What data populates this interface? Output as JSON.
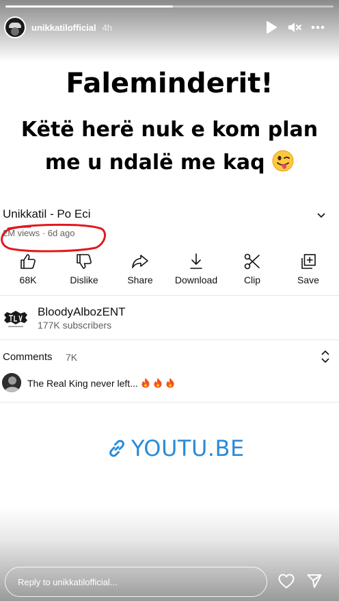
{
  "story": {
    "username": "unikkatilofficial",
    "time_ago": "4h",
    "progress_fraction": 0.51,
    "headline_1": "Faleminderit!",
    "headline_2": "Këtë herë nuk e kom plan",
    "headline_3": "me u ndalë me kaq",
    "headline_emoji": "winking-face-with-tongue",
    "link_text": "YOUTU.BE",
    "reply_placeholder": "Reply to unikkatilofficial..."
  },
  "video": {
    "title": "Unikkatil - Po Eci",
    "meta": "2M views · 6d ago",
    "actions": [
      {
        "label": "68K",
        "icon": "thumbs-up-icon"
      },
      {
        "label": "Dislike",
        "icon": "thumbs-down-icon"
      },
      {
        "label": "Share",
        "icon": "share-icon"
      },
      {
        "label": "Download",
        "icon": "download-icon"
      },
      {
        "label": "Clip",
        "icon": "scissors-icon"
      },
      {
        "label": "Save",
        "icon": "save-playlist-icon"
      }
    ]
  },
  "channel": {
    "name": "BloodyAlbozENT",
    "subscribers": "177K subscribers"
  },
  "comments": {
    "label": "Comments",
    "count": "7K",
    "top_comment": "The Real King never left..."
  },
  "colors": {
    "link_blue": "#2a8bd8",
    "annotation_red": "#e0191f",
    "meta_gray": "#606060"
  }
}
